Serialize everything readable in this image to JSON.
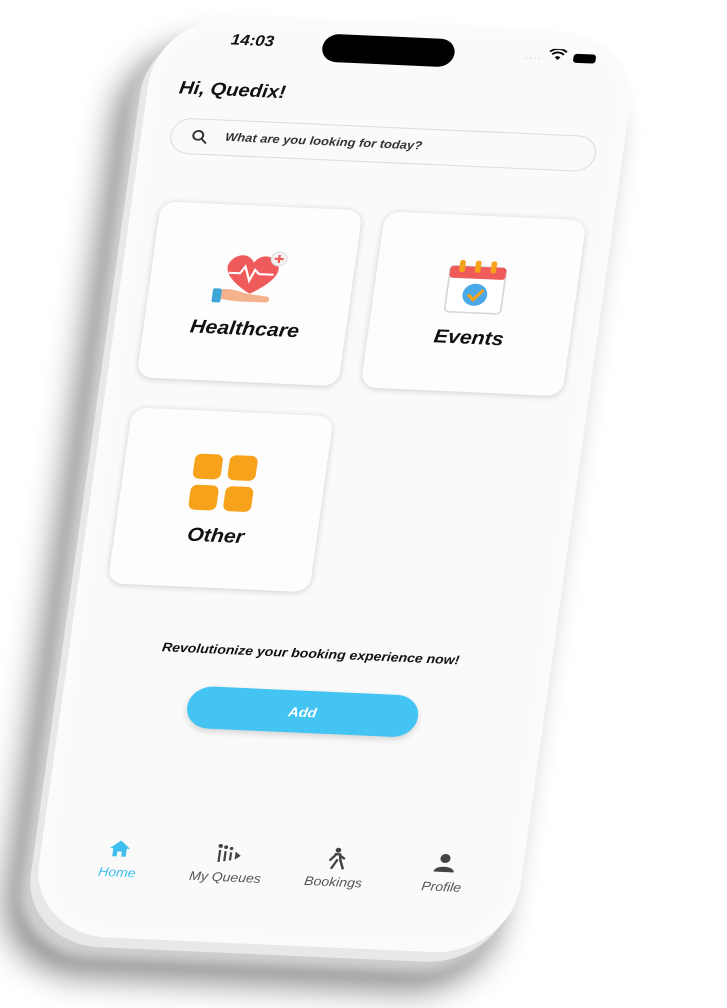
{
  "status_bar": {
    "time": "14:03",
    "signal": "...."
  },
  "header": {
    "greeting": "Hi, Quedix!"
  },
  "search": {
    "placeholder": "What are you looking for today?",
    "icon": "search-icon"
  },
  "categories": [
    {
      "label": "Healthcare",
      "icon": "heart-hand-icon"
    },
    {
      "label": "Events",
      "icon": "calendar-icon"
    },
    {
      "label": "Other",
      "icon": "grid-icon"
    }
  ],
  "promo": {
    "tagline": "Revolutionize your booking experience now!",
    "button_label": "Add"
  },
  "tabs": [
    {
      "label": "Home",
      "icon": "home-icon",
      "active": true
    },
    {
      "label": "My Queues",
      "icon": "queue-icon",
      "active": false
    },
    {
      "label": "Bookings",
      "icon": "walking-person-icon",
      "active": false
    },
    {
      "label": "Profile",
      "icon": "person-icon",
      "active": false
    }
  ],
  "colors": {
    "accent": "#43c4f2",
    "other_icon": "#f7a21b",
    "heart": "#ef5a5a"
  }
}
